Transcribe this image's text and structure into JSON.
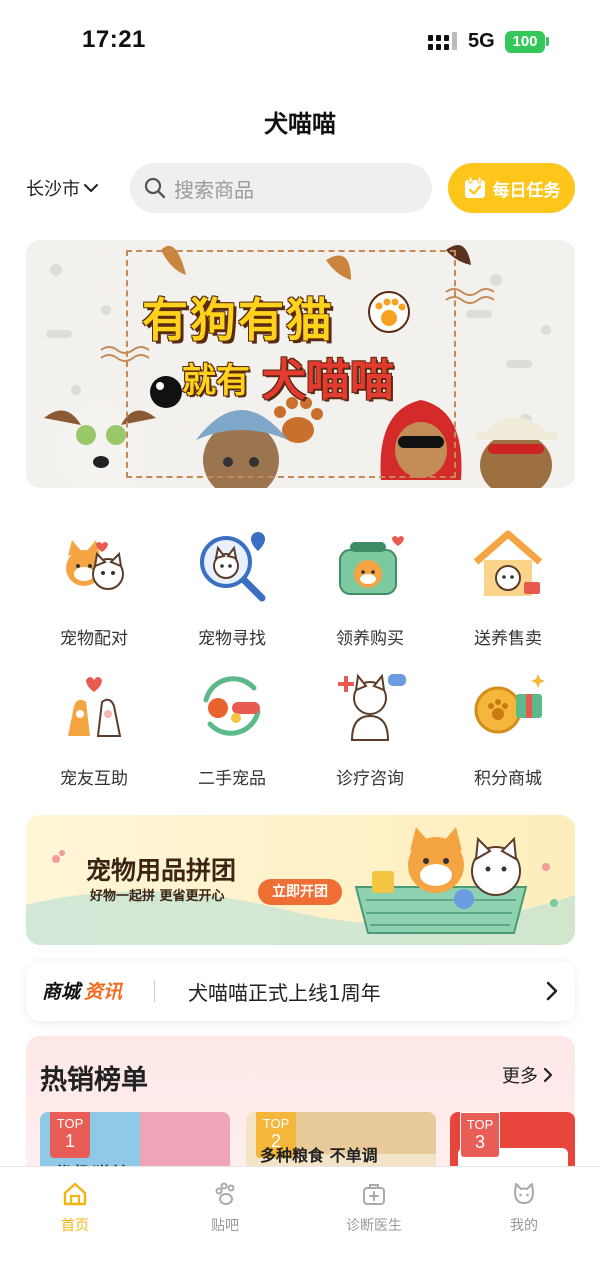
{
  "status_bar": {
    "time": "17:21",
    "network": "5G",
    "battery": "100"
  },
  "header": {
    "title": "犬喵喵"
  },
  "search_row": {
    "city": "长沙市",
    "search_placeholder": "搜索商品",
    "task_button": "每日任务"
  },
  "banner": {
    "line1": "有狗有猫",
    "line2_prefix": "就有",
    "line2_brand": "犬喵喵"
  },
  "categories": [
    {
      "label": "宠物配对",
      "icon": "pet-pairing-icon"
    },
    {
      "label": "宠物寻找",
      "icon": "pet-finder-icon"
    },
    {
      "label": "领养购买",
      "icon": "adopt-buy-icon"
    },
    {
      "label": "送养售卖",
      "icon": "rehome-sell-icon"
    },
    {
      "label": "宠友互助",
      "icon": "mutual-help-icon"
    },
    {
      "label": "二手宠品",
      "icon": "second-hand-icon"
    },
    {
      "label": "诊疗咨询",
      "icon": "vet-consult-icon"
    },
    {
      "label": "积分商城",
      "icon": "points-mall-icon"
    }
  ],
  "group_buy": {
    "title": "宠物用品拼团",
    "subtitle": "好物一起拼 更省更开心",
    "button": "立即开团"
  },
  "news": {
    "tag_part1": "商城",
    "tag_part2": "资讯",
    "headline": "犬喵喵正式上线1周年"
  },
  "hot_list": {
    "title": "热销榜单",
    "more": "更多",
    "items": [
      {
        "badge_top": "TOP",
        "rank": "1",
        "text": "优趣猫粮"
      },
      {
        "badge_top": "TOP",
        "rank": "2",
        "text": "多种粮食 不单调"
      },
      {
        "badge_top": "TOP",
        "rank": "3",
        "text": ""
      }
    ]
  },
  "tabbar": {
    "items": [
      {
        "label": "首页",
        "active": true
      },
      {
        "label": "贴吧",
        "active": false
      },
      {
        "label": "诊断医生",
        "active": false
      },
      {
        "label": "我的",
        "active": false
      }
    ]
  },
  "colors": {
    "accent_yellow": "#fec51b",
    "active_tab": "#f2b50f",
    "news_orange": "#f26b1d",
    "battery_green": "#34c759",
    "rank_red": "#e85d55"
  }
}
